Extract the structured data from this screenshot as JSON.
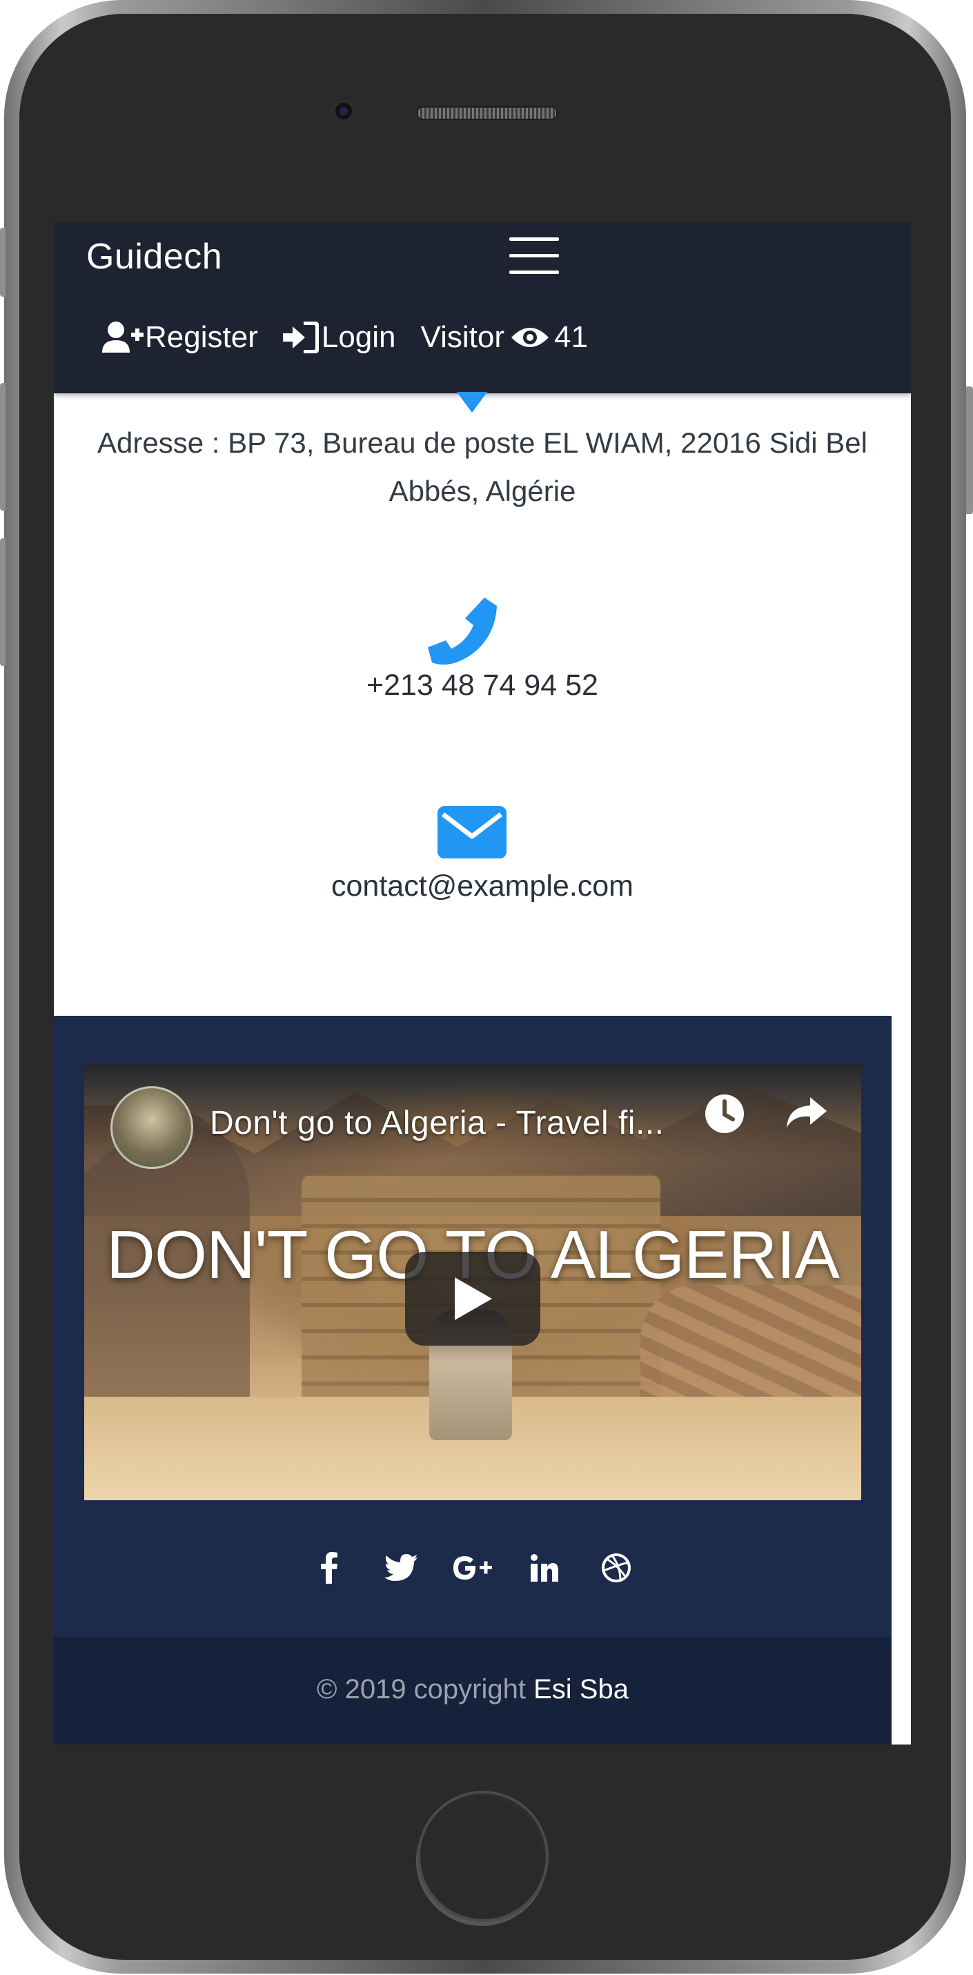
{
  "navbar": {
    "brand": "Guidech",
    "register_label": "Register",
    "login_label": "Login",
    "visitor_label": "Visitor",
    "visitor_count": "41"
  },
  "contact": {
    "address_line1": "Adresse : BP 73, Bureau de poste EL WIAM, 22016 Sidi Bel",
    "address_line2": "Abbés, Algérie",
    "phone": "+213 48 74 94 52",
    "email": "contact@example.com"
  },
  "video": {
    "title": "Don't go to Algeria - Travel fi...",
    "overlay_text": "DON'T GO TO ALGERIA"
  },
  "socials": [
    "facebook-icon",
    "twitter-icon",
    "google-plus-icon",
    "linkedin-icon",
    "dribbble-icon"
  ],
  "footer": {
    "copyright": "© 2019 copyright",
    "company": "Esi Sba"
  },
  "colors": {
    "navbar_bg": "#1e2331",
    "accent": "#2196f3",
    "footer_top": "#1c2a4c",
    "footer_bottom": "#16213b"
  }
}
